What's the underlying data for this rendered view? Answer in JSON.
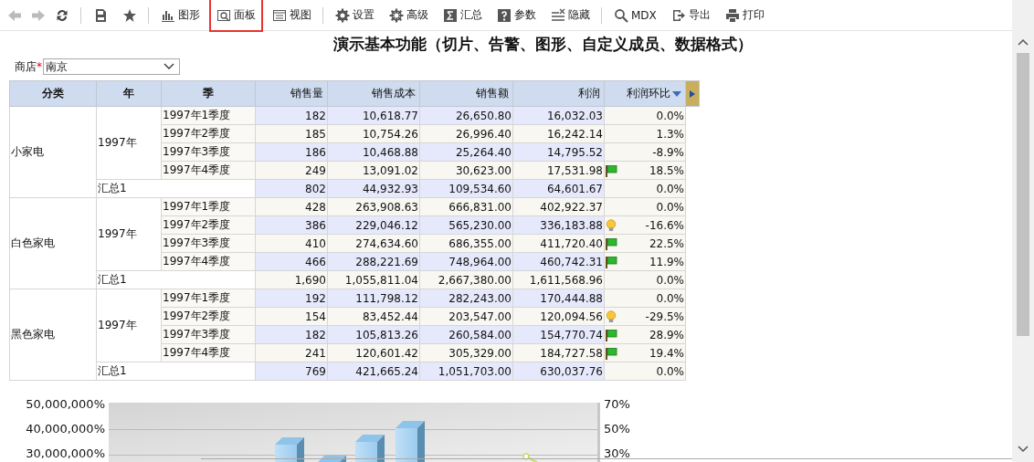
{
  "toolbar": {
    "nav": [
      {
        "kind": "back",
        "disabled": true
      },
      {
        "kind": "forward",
        "disabled": true
      },
      {
        "kind": "refresh",
        "disabled": false
      }
    ],
    "items": [
      {
        "kind": "save",
        "selected": false
      },
      {
        "kind": "star",
        "selected": false
      },
      {
        "kind": "chart",
        "label": "图形",
        "selected": false
      },
      {
        "kind": "panel",
        "label": "面板",
        "selected": true
      },
      {
        "kind": "view",
        "label": "视图",
        "selected": false
      },
      {
        "kind": "gear",
        "label": "设置",
        "selected": false
      },
      {
        "kind": "gear2",
        "label": "高级",
        "selected": false
      },
      {
        "kind": "sigma",
        "label": "汇总",
        "selected": false
      },
      {
        "kind": "question",
        "label": "参数",
        "selected": false
      },
      {
        "kind": "hide",
        "label": "隐藏",
        "selected": false
      },
      {
        "kind": "search",
        "label": "MDX",
        "selected": false
      },
      {
        "kind": "export",
        "label": "导出",
        "selected": false
      },
      {
        "kind": "print",
        "label": "打印",
        "selected": false
      }
    ]
  },
  "title": "演示基本功能（切片、告警、图形、自定义成员、数据格式）",
  "filter": {
    "label": "商店",
    "required_mark": "*",
    "value": "南京"
  },
  "table": {
    "columns": [
      "分类",
      "年",
      "季",
      "销售量",
      "销售成本",
      "销售额",
      "利润",
      "利润环比"
    ],
    "groups": [
      {
        "category": "小家电",
        "year": "1997年",
        "rows": [
          {
            "quarter": "1997年1季度",
            "values": [
              "182",
              "10,618.77",
              "26,650.80",
              "16,032.03",
              "0.0%"
            ],
            "kind": "plain"
          },
          {
            "quarter": "1997年2季度",
            "values": [
              "185",
              "10,754.26",
              "26,996.40",
              "16,242.14",
              "1.3%"
            ],
            "kind": "plain"
          },
          {
            "quarter": "1997年3季度",
            "values": [
              "186",
              "10,468.88",
              "25,264.40",
              "14,795.52",
              "-8.9%"
            ],
            "kind": "plain"
          },
          {
            "quarter": "1997年4季度",
            "values": [
              "249",
              "13,091.02",
              "30,623.00",
              "17,531.98",
              "18.5%"
            ],
            "kind": "flag"
          }
        ],
        "total": {
          "label": "汇总1",
          "values": [
            "802",
            "44,932.93",
            "109,534.60",
            "64,601.67",
            "0.0%"
          ]
        }
      },
      {
        "category": "白色家电",
        "year": "1997年",
        "rows": [
          {
            "quarter": "1997年1季度",
            "values": [
              "428",
              "263,908.63",
              "666,831.00",
              "402,922.37",
              "0.0%"
            ],
            "kind": "plain"
          },
          {
            "quarter": "1997年2季度",
            "values": [
              "386",
              "229,046.12",
              "565,230.00",
              "336,183.88",
              "-16.6%"
            ],
            "kind": "bulb"
          },
          {
            "quarter": "1997年3季度",
            "values": [
              "410",
              "274,634.60",
              "686,355.00",
              "411,720.40",
              "22.5%"
            ],
            "kind": "flag"
          },
          {
            "quarter": "1997年4季度",
            "values": [
              "466",
              "288,221.69",
              "748,964.00",
              "460,742.31",
              "11.9%"
            ],
            "kind": "flag"
          }
        ],
        "total": {
          "label": "汇总1",
          "values": [
            "1,690",
            "1,055,811.04",
            "2,667,380.00",
            "1,611,568.96",
            "0.0%"
          ]
        }
      },
      {
        "category": "黑色家电",
        "year": "1997年",
        "rows": [
          {
            "quarter": "1997年1季度",
            "values": [
              "192",
              "111,798.12",
              "282,243.00",
              "170,444.88",
              "0.0%"
            ],
            "kind": "plain"
          },
          {
            "quarter": "1997年2季度",
            "values": [
              "154",
              "83,452.44",
              "203,547.00",
              "120,094.56",
              "-29.5%"
            ],
            "kind": "bulb"
          },
          {
            "quarter": "1997年3季度",
            "values": [
              "182",
              "105,813.26",
              "260,584.00",
              "154,770.74",
              "28.9%"
            ],
            "kind": "flag"
          },
          {
            "quarter": "1997年4季度",
            "values": [
              "241",
              "120,601.42",
              "305,329.00",
              "184,727.58",
              "19.4%"
            ],
            "kind": "flag"
          }
        ],
        "total": {
          "label": "汇总1",
          "values": [
            "769",
            "421,665.24",
            "1,051,703.00",
            "630,037.76",
            "0.0%"
          ]
        }
      }
    ]
  },
  "chart": {
    "left_ticks": [
      "50,000,000%",
      "40,000,000%",
      "30,000,000%"
    ],
    "right_ticks": [
      "70%",
      "50%",
      "30%"
    ]
  }
}
